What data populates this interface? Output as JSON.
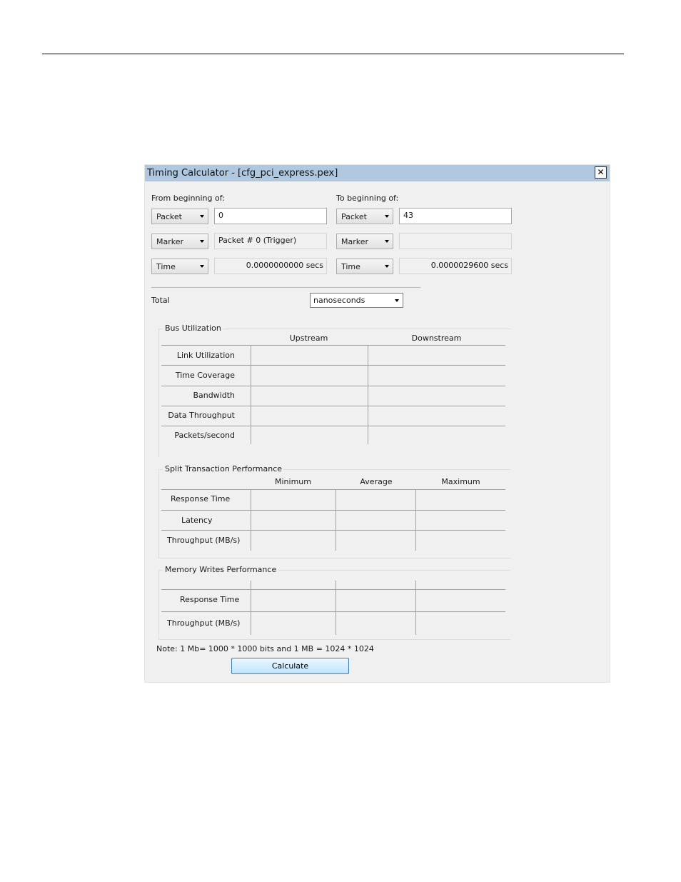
{
  "dialog": {
    "title": "Timing Calculator - [cfg_pci_express.pex]",
    "close_glyph": "✕"
  },
  "from": {
    "heading": "From beginning of:",
    "packet_combo": "Packet",
    "packet_value": "0",
    "marker_combo": "Marker",
    "marker_value": "Packet # 0 (Trigger)",
    "time_combo": "Time",
    "time_value": "0.0000000000 secs"
  },
  "to": {
    "heading": "To beginning of:",
    "packet_combo": "Packet",
    "packet_value": "43",
    "marker_combo": "Marker",
    "marker_value": "",
    "time_combo": "Time",
    "time_value": "0.0000029600 secs"
  },
  "total": {
    "label": "Total",
    "unit": "nanoseconds"
  },
  "bus_utilization": {
    "title": "Bus Utilization",
    "columns": [
      "Upstream",
      "Downstream"
    ],
    "rows": [
      "Link Utilization",
      "Time Coverage",
      "Bandwidth",
      "Data Throughput",
      "Packets/second"
    ]
  },
  "split_transaction": {
    "title": "Split Transaction Performance",
    "columns": [
      "Minimum",
      "Average",
      "Maximum"
    ],
    "rows": [
      "Response Time",
      "Latency",
      "Throughput (MB/s)"
    ]
  },
  "memory_writes": {
    "title": "Memory Writes Performance",
    "rows": [
      "Response Time",
      "Throughput (MB/s)"
    ]
  },
  "note": "Note: 1 Mb= 1000 * 1000 bits and 1 MB = 1024 * 1024",
  "calculate_label": "Calculate"
}
